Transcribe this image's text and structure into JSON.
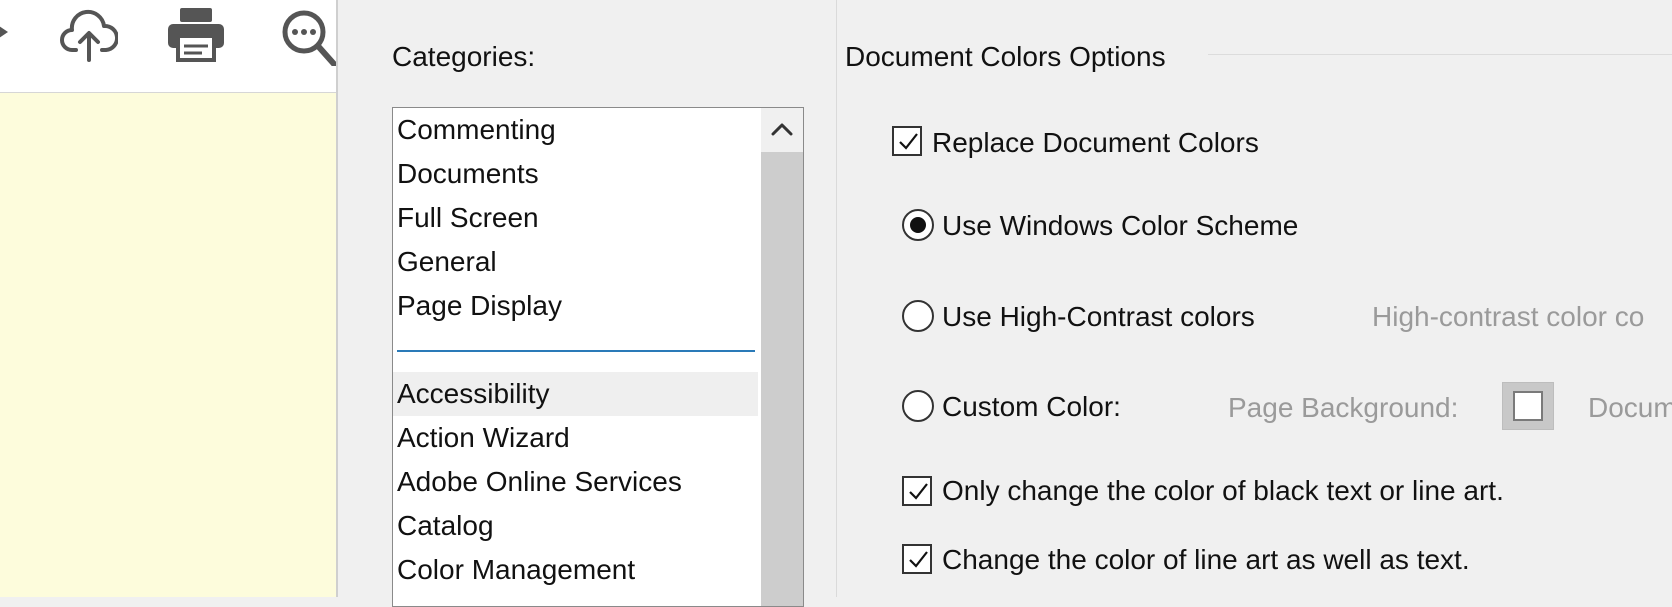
{
  "toolbar": {
    "icons": [
      "dropdown-arrow-icon",
      "cloud-upload-icon",
      "print-icon",
      "zoom-search-icon"
    ]
  },
  "dialog": {
    "categories_label": "Categories:",
    "categories": [
      "Commenting",
      "Documents",
      "Full Screen",
      "General",
      "Page Display",
      "Accessibility",
      "Action Wizard",
      "Adobe Online Services",
      "Catalog",
      "Color Management"
    ],
    "selected_category": "Accessibility",
    "options_title": "Document Colors Options",
    "replace_colors": {
      "label": "Replace Document Colors",
      "checked": true
    },
    "radio_windows": {
      "label": "Use Windows Color Scheme",
      "selected": true
    },
    "radio_high_contrast": {
      "label": "Use High-Contrast colors",
      "selected": false
    },
    "high_contrast_combo_label": "High-contrast color co",
    "radio_custom": {
      "label": "Custom Color:",
      "selected": false
    },
    "page_background_label": "Page Background:",
    "document_text_label": "Docum",
    "only_black_text": {
      "label": "Only change the color of black text or line art.",
      "checked": true
    },
    "line_art_text": {
      "label": "Change the color of line art as well as text.",
      "checked": true
    }
  },
  "colors": {
    "page_background": "#fdfcdc",
    "dialog_background": "#f0f0f0",
    "separator_accent": "#2a7ab8"
  }
}
